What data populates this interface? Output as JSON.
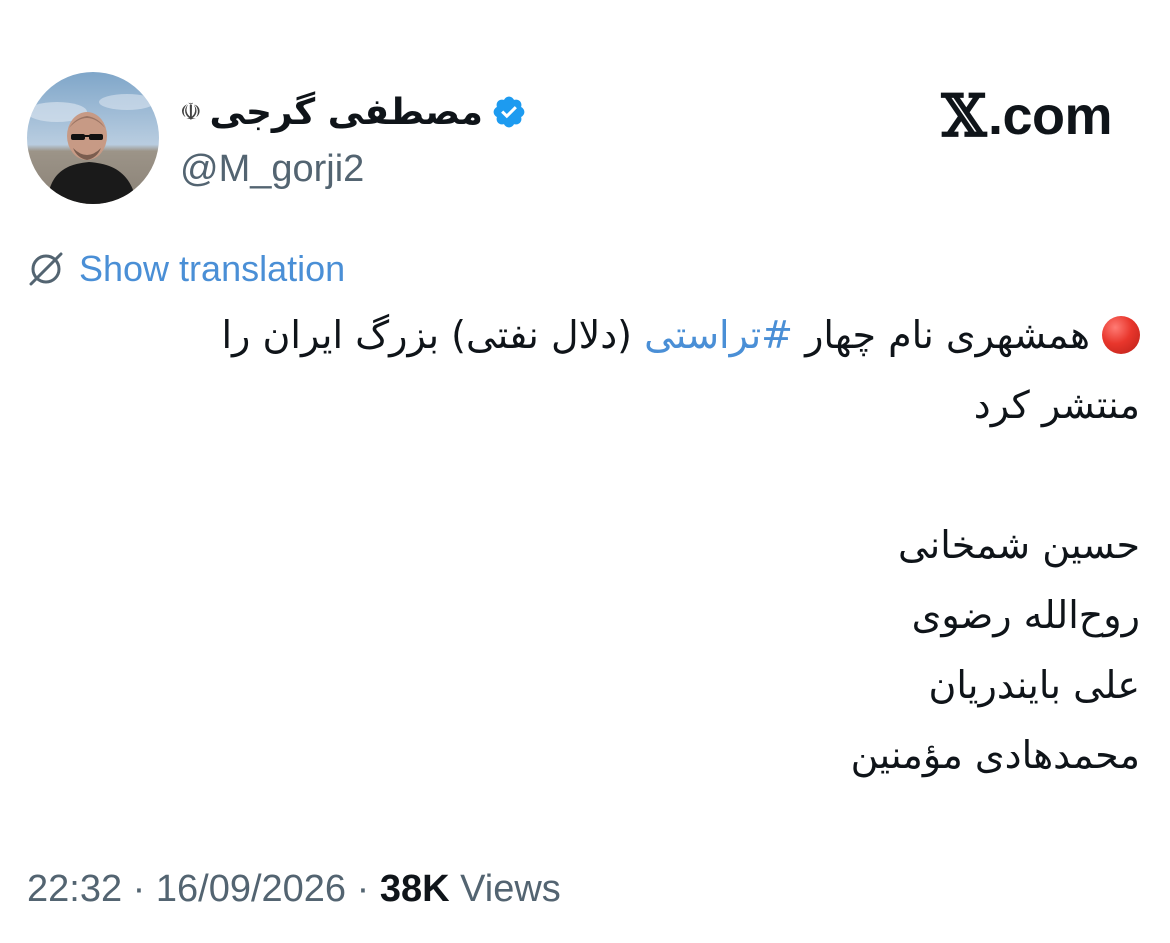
{
  "brand": {
    "logo_glyph": "𝕏",
    "domain": ".com"
  },
  "author": {
    "display_name": "مصطفی گرجی",
    "emblem": "☫",
    "handle": "@M_gorji2",
    "verified": true
  },
  "translation": {
    "label": "Show translation"
  },
  "tweet": {
    "line1_before_hashtag": "همشهری نام چهار ",
    "hashtag": "#تراستی",
    "line1_after_hashtag": " (دلال نفتی) بزرگ ایران را",
    "line2": "منتشر کرد",
    "names": [
      "حسین شمخانی",
      "روح‌الله رضوی",
      "علی بایندریان",
      "محمدهادی مؤمنین"
    ]
  },
  "meta": {
    "time": "22:32",
    "separator": "·",
    "date": "16/09/2026",
    "views_count": "38K",
    "views_label": "Views"
  },
  "colors": {
    "link": "#4a8fd6",
    "secondary_text": "#536471",
    "verified": "#1d9bf0",
    "red_dot": "#e8362c"
  }
}
